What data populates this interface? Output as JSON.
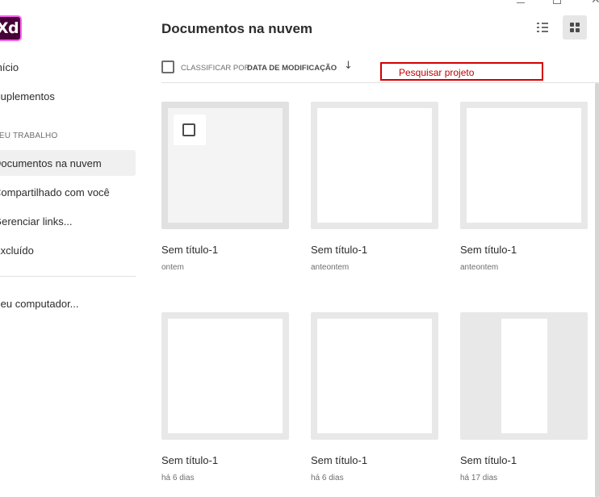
{
  "app": {
    "logo_text": "Xd"
  },
  "sidebar": {
    "home": "Início",
    "plugins": "Suplementos",
    "section_label": "SEU TRABALHO",
    "items": [
      {
        "label": "Documentos na nuvem",
        "active": true
      },
      {
        "label": "Compartilhado com você",
        "active": false
      },
      {
        "label": "Gerenciar links...",
        "active": false
      },
      {
        "label": "Excluído",
        "active": false
      }
    ],
    "your_computer": "Seu computador..."
  },
  "header": {
    "title": "Documentos na nuvem",
    "view_list_icon": "list-view-icon",
    "view_grid_icon": "grid-view-icon",
    "active_view": "grid"
  },
  "sort": {
    "label": "CLASSIFICAR POR",
    "value": "DATA DE MODIFICAÇÃO",
    "direction_icon": "arrow-down-icon"
  },
  "search": {
    "placeholder": "Pesquisar projeto",
    "value": ""
  },
  "documents": [
    {
      "title": "Sem título-1",
      "date": "ontem",
      "selected": true
    },
    {
      "title": "Sem título-1",
      "date": "anteontem",
      "selected": false
    },
    {
      "title": "Sem título-1",
      "date": "anteontem",
      "selected": false
    },
    {
      "title": "Sem título-1",
      "date": "há 6 dias",
      "selected": false
    },
    {
      "title": "Sem título-1",
      "date": "há 6 dias",
      "selected": false
    },
    {
      "title": "Sem título-1",
      "date": "há 17 dias",
      "selected": false
    }
  ],
  "colors": {
    "accent": "#ff61f6",
    "logo_bg": "#470137",
    "search_border": "#d40000",
    "active_item_bg": "#f0f0f0"
  }
}
